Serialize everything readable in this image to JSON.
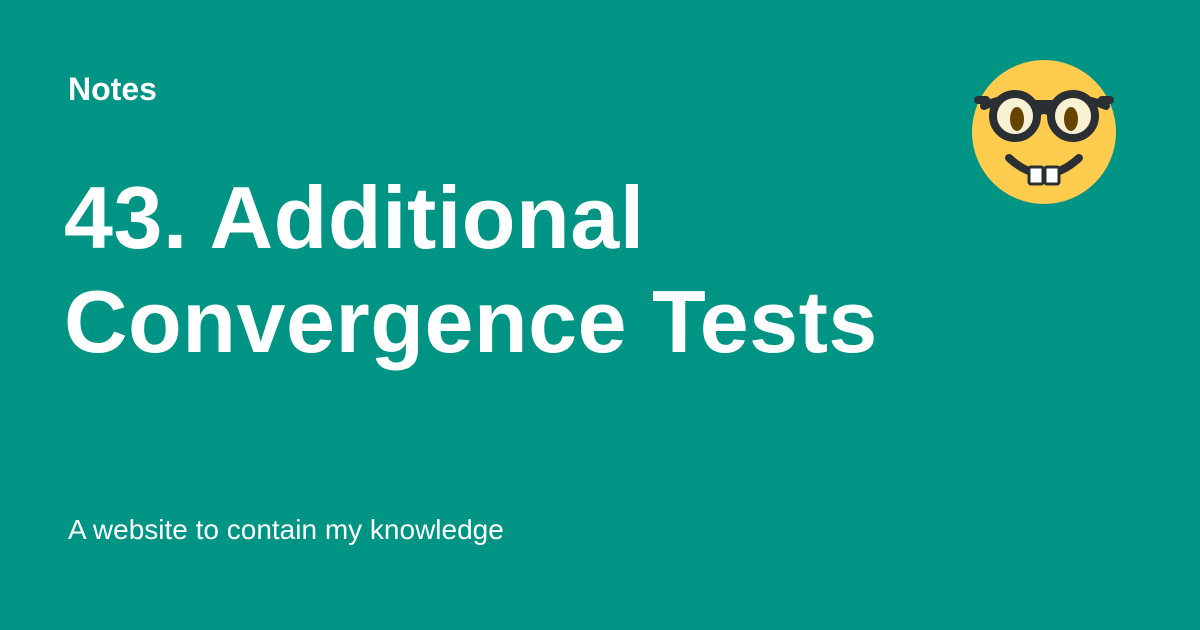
{
  "site": {
    "name": "Notes",
    "tagline": "A website to contain my knowledge"
  },
  "page": {
    "title": "43. Additional Convergence Tests"
  },
  "emoji": {
    "icon": "nerd-face-icon"
  },
  "colors": {
    "background": "#009485",
    "text": "#ffffff",
    "emoji_face": "#FFCC4D",
    "emoji_features": "#292F33"
  }
}
